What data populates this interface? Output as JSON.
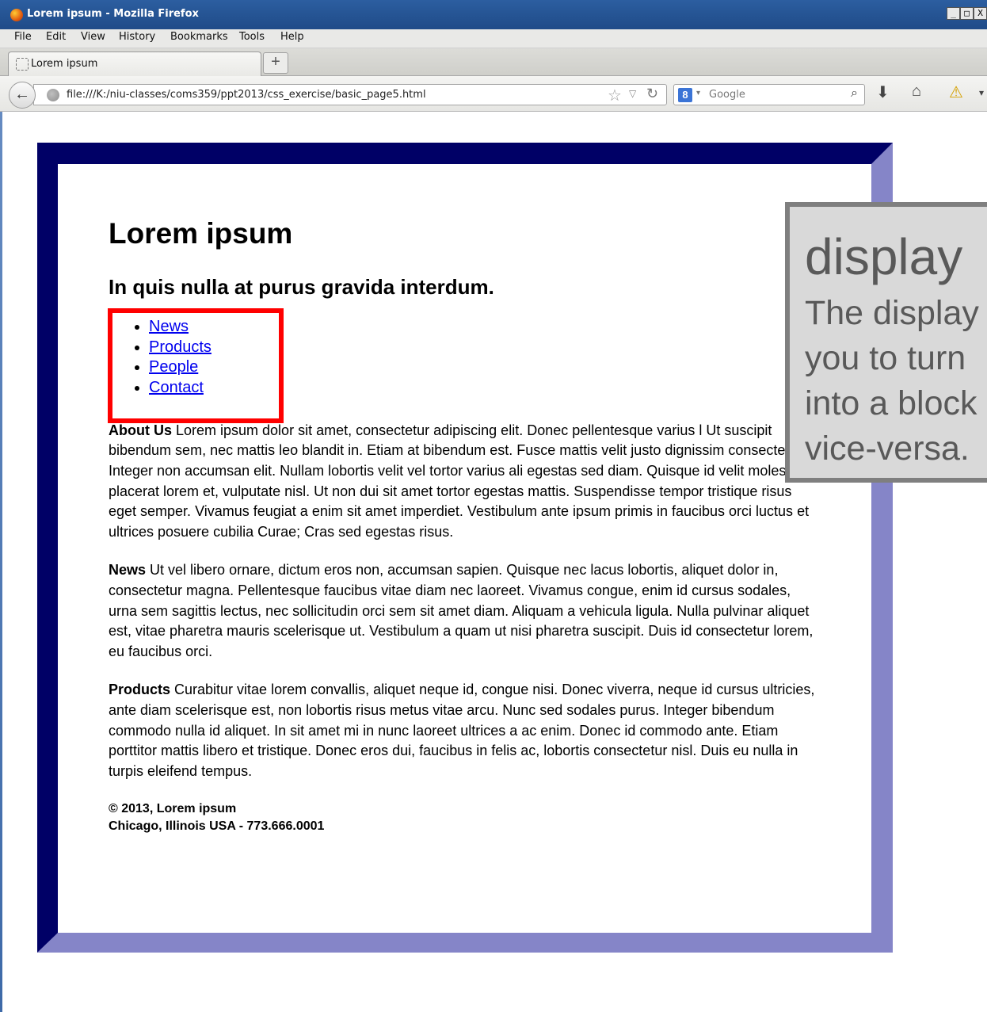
{
  "window": {
    "title": "Lorem ipsum - Mozilla Firefox",
    "controls": {
      "minimize": "_",
      "maximize": "□",
      "close": "X"
    }
  },
  "menubar": {
    "items": [
      "File",
      "Edit",
      "View",
      "History",
      "Bookmarks",
      "Tools",
      "Help"
    ]
  },
  "tabs": [
    {
      "label": "Lorem ipsum",
      "active": true
    }
  ],
  "newtab_label": "+",
  "navbar": {
    "url": "file:///K:/niu-classes/coms359/ppt2013/css_exercise/basic_page5.html",
    "search_engine_badge": "8",
    "search_placeholder": "Google"
  },
  "page": {
    "heading": "Lorem ipsum",
    "subheading": "In quis nulla at purus gravida interdum.",
    "nav_links": [
      "News",
      "Products",
      "People",
      "Contact"
    ],
    "paragraphs": [
      {
        "lead": "About Us",
        "text": " Lorem ipsum dolor sit amet, consectetur adipiscing elit. Donec pellentesque varius l Ut suscipit bibendum sem, nec mattis leo blandit in. Etiam at bibendum est. Fusce mattis velit justo dignissim consectetur. Integer non accumsan elit. Nullam lobortis velit vel tortor varius ali egestas sed diam. Quisque id velit molestie, placerat lorem et, vulputate nisl. Ut non dui sit amet tortor egestas mattis. Suspendisse tempor tristique risus eget semper. Vivamus feugiat a enim sit amet imperdiet. Vestibulum ante ipsum primis in faucibus orci luctus et ultrices posuere cubilia Curae; Cras sed egestas risus."
      },
      {
        "lead": "News",
        "text": " Ut vel libero ornare, dictum eros non, accumsan sapien. Quisque nec lacus lobortis, aliquet dolor in, consectetur magna. Pellentesque faucibus vitae diam nec laoreet. Vivamus congue, enim id cursus sodales, urna sem sagittis lectus, nec sollicitudin orci sem sit amet diam. Aliquam a vehicula ligula. Nulla pulvinar aliquet est, vitae pharetra mauris scelerisque ut. Vestibulum a quam ut nisi pharetra suscipit. Duis id consectetur lorem, eu faucibus orci."
      },
      {
        "lead": "Products",
        "text": " Curabitur vitae lorem convallis, aliquet neque id, congue nisi. Donec viverra, neque id cursus ultricies, ante diam scelerisque est, non lobortis risus metus vitae arcu. Nunc sed sodales purus. Integer bibendum commodo nulla id aliquet. In sit amet mi in nunc laoreet ultrices a ac enim. Donec id commodo ante. Etiam porttitor mattis libero et tristique. Donec eros dui, faucibus in felis ac, lobortis consectetur nisl. Duis eu nulla in turpis eleifend tempus."
      }
    ],
    "footer_line1": "© 2013, Lorem ipsum",
    "footer_line2": "Chicago, Illinois USA - 773.666.0001"
  },
  "callout": {
    "title": "display",
    "body": "The display\nyou to turn\ninto a block\nvice-versa."
  },
  "colors": {
    "frame_dark": "#000066",
    "frame_light": "#8585c8",
    "highlight_box": "#ff0000",
    "callout_bg": "#d9d9d9",
    "callout_border": "#7f7f7f"
  },
  "icons": [
    "firefox-logo-icon",
    "blank-page-icon",
    "back-arrow-icon",
    "globe-icon",
    "star-icon",
    "dropdown-icon",
    "reload-icon",
    "search-engine-icon",
    "magnifier-icon",
    "download-icon",
    "home-icon",
    "warning-icon"
  ]
}
